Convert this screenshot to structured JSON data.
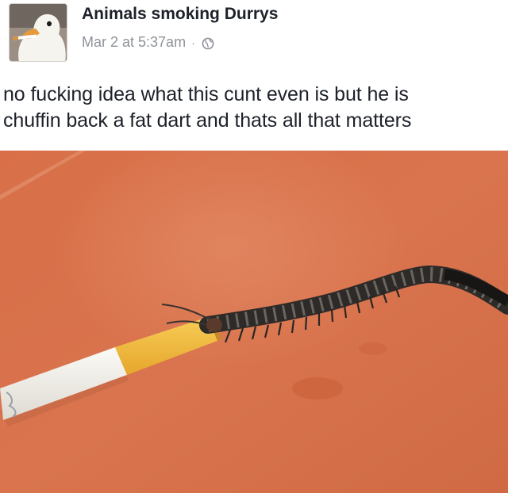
{
  "post": {
    "page_name": "Animals smoking Durrys",
    "timestamp": "Mar 2 at 5:37am",
    "separator": "·",
    "audience_icon": "globe-icon",
    "caption_lines": [
      "no fucking idea what this cunt even is but he is",
      "chuffin back a fat dart and thats all that matters"
    ],
    "avatar_icon": "duck-smoking-avatar",
    "photo_subject": "centipede-with-cigarette-photo"
  },
  "colors": {
    "name_text": "#1d2129",
    "meta_text": "#8f939a",
    "ground": "#d9704a",
    "cigarette_filter": "#f0b83a",
    "cigarette_paper": "#f5f3ee",
    "centipede_body": "#3a3532"
  }
}
